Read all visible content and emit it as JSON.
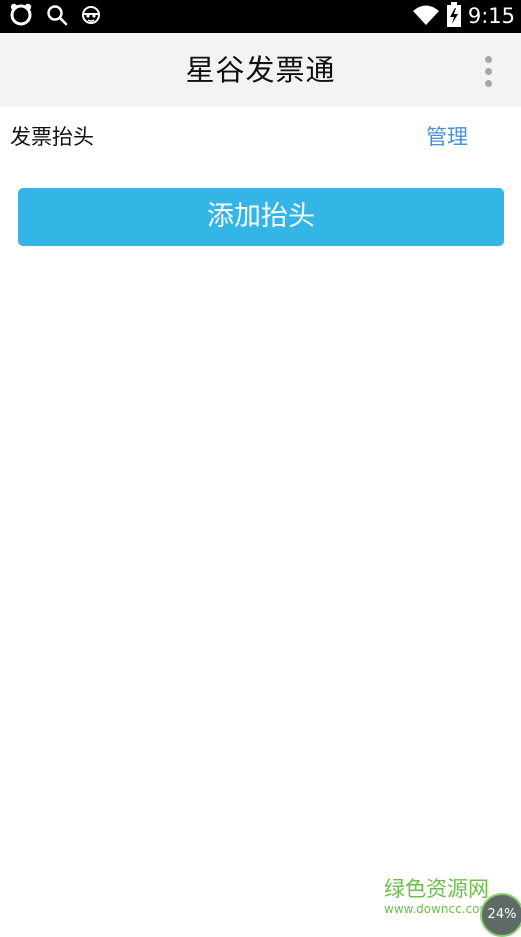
{
  "status_bar": {
    "time": "9:15",
    "left_icons": [
      "app-notification-icon",
      "search-icon",
      "face-icon"
    ],
    "right_icons": [
      "wifi-icon",
      "battery-charging-icon"
    ]
  },
  "app_bar": {
    "title": "星谷发票通",
    "menu_icon": "overflow-menu-icon"
  },
  "invoice_header": {
    "label": "发票抬头",
    "manage_label": "管理"
  },
  "add_button": {
    "label": "添加抬头"
  },
  "watermark": {
    "text": "绿色资源网",
    "url": "www.downcc.com"
  },
  "badge": {
    "percent": "24%"
  },
  "colors": {
    "accent": "#33b5e5",
    "link": "#4a90d9",
    "app_bar_bg": "#f3f3f3",
    "watermark": "#6cc04a"
  }
}
